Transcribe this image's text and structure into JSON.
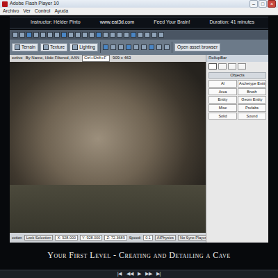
{
  "window": {
    "title": "Adobe Flash Player 10",
    "controls": [
      "–",
      "□",
      "×"
    ]
  },
  "menu": [
    "Archivo",
    "Ver",
    "Control",
    "Ayuda"
  ],
  "banner": {
    "instructor": "Instructor: Hélder Pinto",
    "site": "www.eat3d.com",
    "slogan": "Feed Your Brain!",
    "duration": "Duration: 41 minutes"
  },
  "editor": {
    "toolbar_buttons": [
      "Terrain",
      "Texture",
      "Lighting"
    ],
    "asset_browser": "Open asset browser",
    "viewport_header": {
      "title": "ective",
      "filter": "By Name, Hide Filtered, AAN",
      "search": "Ctrl+Shift+F",
      "size": "909 x 463"
    },
    "rollup": {
      "title": "RollupBar",
      "tabs": [
        {
          "selected": true
        },
        {
          "selected": false
        },
        {
          "selected": false
        },
        {
          "selected": false
        }
      ],
      "section": "Objects",
      "buttons": [
        "AI",
        "Archetype Entity",
        "Area",
        "Brush",
        "Entity",
        "Geom Entity",
        "Misc",
        "Prefabs",
        "Solid",
        "Sound"
      ]
    },
    "status": {
      "left": "ection",
      "lock": "Lock Selection",
      "x": "X: 928.000",
      "y": "Y: 928.000",
      "z": "Z: 72.3689",
      "speed_label": "Speed:",
      "speed": "0.1",
      "buttons": [
        "AIPhysics",
        "No Sync Player"
      ]
    }
  },
  "caption": "Your First Level - Creating and Detailing a Cave",
  "player_controls": [
    "|◀",
    "◀◀",
    "▶",
    "▶▶",
    "▶|"
  ]
}
